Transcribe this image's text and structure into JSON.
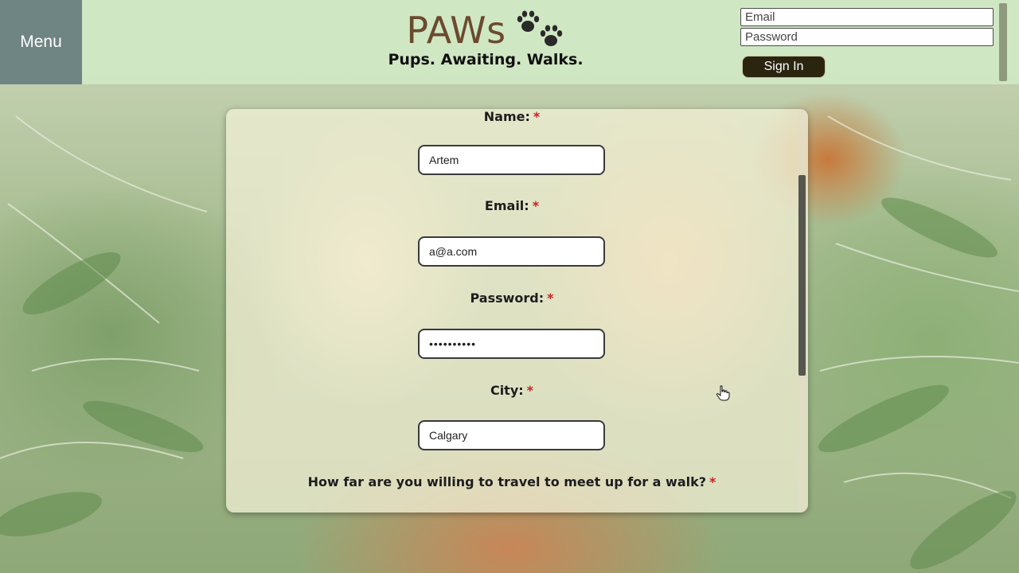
{
  "header": {
    "menu_label": "Menu",
    "brand_title": "PAWs",
    "brand_icon": "paw-prints-icon",
    "tagline": "Pups. Awaiting. Walks.",
    "signin": {
      "email_placeholder": "Email",
      "password_placeholder": "Password",
      "button_label": "Sign In"
    }
  },
  "form": {
    "fields": [
      {
        "label": "Name:",
        "required_mark": "*",
        "value": "Artem",
        "type": "text"
      },
      {
        "label": "Email:",
        "required_mark": "*",
        "value": "a@a.com",
        "type": "text"
      },
      {
        "label": "Password:",
        "required_mark": "*",
        "value": "••••••••••",
        "type": "password"
      },
      {
        "label": "City:",
        "required_mark": "*",
        "value": "Calgary",
        "type": "text"
      }
    ],
    "question": "How far are you willing to travel to meet up for a walk?",
    "question_required_mark": "*"
  },
  "colors": {
    "header_bg": "#d0e8c4",
    "menu_bg": "#6f8583",
    "brand": "#6b4a2e",
    "signin_bg": "#2b2510",
    "required": "#cc1f1f",
    "panel_bg": "#f3f0d6"
  },
  "cursor_icon": "hand-pointer-icon"
}
